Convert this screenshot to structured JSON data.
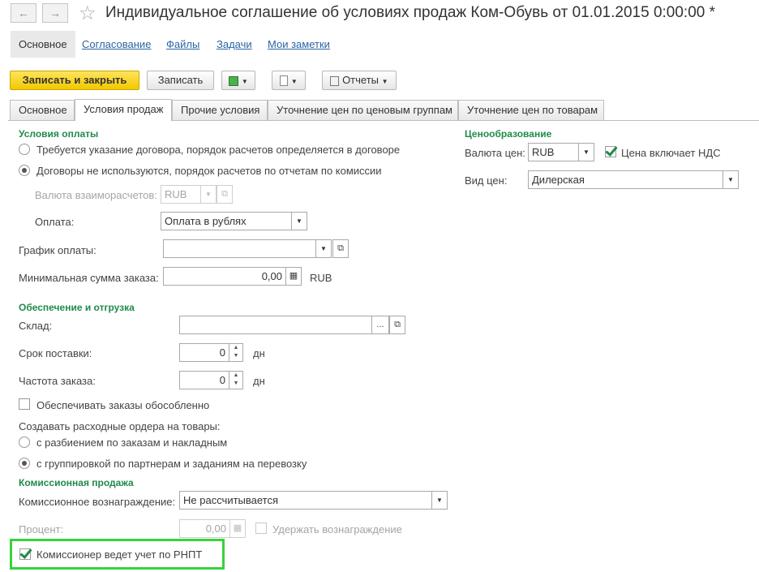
{
  "window": {
    "title": "Индивидуальное соглашение об условиях продаж Ком-Обувь от 01.01.2015 0:00:00 *",
    "back_icon": "arrow-left-icon",
    "forward_icon": "arrow-right-icon",
    "favorite_icon": "star-icon"
  },
  "nav": {
    "tabs": [
      "Основное",
      "Согласование",
      "Файлы",
      "Задачи",
      "Мои заметки"
    ]
  },
  "toolbar": {
    "save_close": "Записать и закрыть",
    "save": "Записать",
    "reports": "Отчеты"
  },
  "tabs": [
    "Основное",
    "Условия продаж",
    "Прочие условия",
    "Уточнение цен по ценовым группам",
    "Уточнение цен по товарам"
  ],
  "payment": {
    "header": "Условия оплаты",
    "radio1": "Требуется указание договора, порядок расчетов определяется в договоре",
    "radio2": "Договоры не используются, порядок расчетов по отчетам по комиссии",
    "settle_currency_label": "Валюта взаиморасчетов:",
    "settle_currency_value": "RUB",
    "payment_label": "Оплата:",
    "payment_value": "Оплата в рублях",
    "schedule_label": "График оплаты:",
    "schedule_value": "",
    "min_sum_label": "Минимальная сумма заказа:",
    "min_sum_value": "0,00",
    "min_sum_currency": "RUB"
  },
  "pricing": {
    "header": "Ценообразование",
    "currency_label": "Валюта цен:",
    "currency_value": "RUB",
    "vat_label": "Цена включает НДС",
    "price_type_label": "Вид цен:",
    "price_type_value": "Дилерская"
  },
  "shipping": {
    "header": "Обеспечение и отгрузка",
    "warehouse_label": "Склад:",
    "warehouse_value": "",
    "delivery_label": "Срок поставки:",
    "delivery_value": "0",
    "delivery_unit": "дн",
    "frequency_label": "Частота заказа:",
    "frequency_value": "0",
    "frequency_unit": "дн",
    "separate_label": "Обеспечивать заказы обособленно",
    "orders_label": "Создавать расходные ордера на товары:",
    "orders_radio1": "с разбиением по заказам и накладным",
    "orders_radio2": "с группировкой по партнерам и заданиям на перевозку"
  },
  "commission": {
    "header": "Комиссионная продажа",
    "fee_label": "Комиссионное вознаграждение:",
    "fee_value": "Не рассчитывается",
    "percent_label": "Процент:",
    "percent_value": "0,00",
    "withhold_label": "Удержать вознаграждение",
    "rnpt_label": "Комиссионер ведет учет по РНПТ"
  },
  "colors": {
    "group_header": "#1f8a4a",
    "primary_button": "#f2c800",
    "highlight_frame": "#39d23a",
    "link": "#2a64a7"
  }
}
